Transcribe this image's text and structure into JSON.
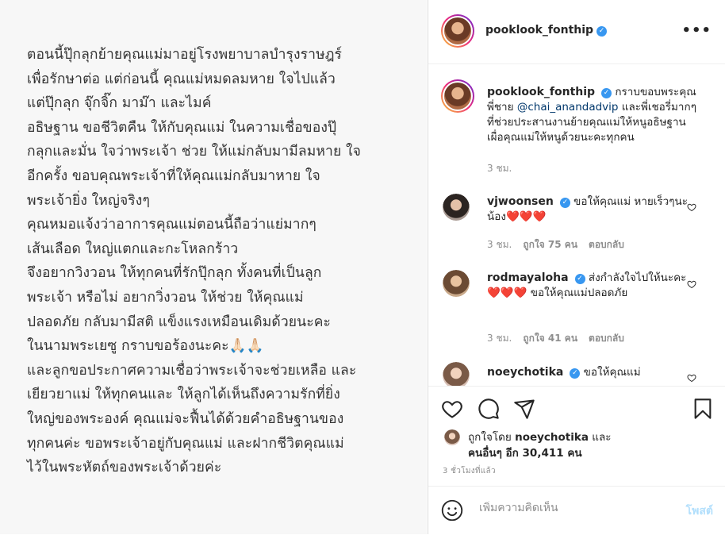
{
  "post": {
    "text": "ตอนนี้ปุ๊กลุกย้ายคุณแม่มาอยู่โรงพยาบาลบำรุงราษฎร์\nเพื่อรักษาต่อ แต่ก่อนนี้ คุณแม่หมดลมหาย ใจไปแล้ว\nแต่ปุ๊กลุก จุ๊กจิ๊ก มาม๊า และไมค์\nอธิษฐาน ขอชีวิตคืน ให้กับคุณแม่  ในความเชื่อของปุ๊\nกลุกและมั่น ใจว่าพระเจ้า ช่วย ให้แม่กลับมามีลมหาย ใจ\nอีกครั้ง ขอบคุณพระเจ้าที่ให้คุณแม่กลับมาหาย ใจ\nพระเจ้ายิ่ง ใหญ่จริงๆ\nคุณหมอแจ้งว่าอาการคุณแม่ตอนนี้ถือว่าแย่มากๆ\nเส้นเลือด ใหญ่แตกและกะโหลกร้าว\nจึงอยากวิงวอน ให้ทุกคนที่รักปุ๊กลุก  ทั้งคนที่เป็นลูก\nพระเจ้า หรือไม่ อยากวิ่งวอน ให้ช่วย ให้คุณแม่\nปลอดภัย กลับมามีสติ แข็งแรงเหมือนเดิมด้วยนะคะ\nในนามพระเยซู กราบขอร้องนะคะ🙏🏻🙏🏻\nและลูกขอประกาศความเชื่อว่าพระเจ้าจะช่วยเหลือ และ\nเยียวยาแม่  ให้ทุกคนและ ให้ลูกได้เห็นถึงความรักที่ยิ่ง\nใหญ่ของพระองค์ คุณแม่จะฟื้นได้ด้วยคำอธิษฐานของ\nทุกคนค่ะ ขอพระเจ้าอยู่กับคุณแม่ และฝากชีวิตคุณแม่\nไว้ในพระหัตถ์ของพระเจ้าด้วยค่ะ"
  },
  "header": {
    "username": "pooklook_fonthip",
    "verified_icon": "verified-badge-icon",
    "more_icon": "more-options-icon",
    "more_glyph": "•••"
  },
  "caption": {
    "username": "pooklook_fonthip",
    "text_before": "กราบขอบพระคุณพี่ชาย ",
    "mention": "@chai_anandadvip",
    "text_after": " และพี่เชอรี่มากๆที่ช่วยประสานงานย้ายคุณแม่ให้หนูอธิษฐานเผื่อคุณแม่ให้หนูด้วยนะคะทุกคน",
    "time": "3 ชม."
  },
  "comments": [
    {
      "username": "vjwoonsen",
      "text": "ขอให้คุณแม่ หายเร็วๆนะน้อง",
      "emoji": "❤️❤️❤️",
      "time": "3 ชม.",
      "likes": "ถูกใจ 75 คน",
      "reply": "ตอบกลับ"
    },
    {
      "username": "rodmayaloha",
      "text": "ส่งกำลังใจไปให้นะคะ",
      "emoji": "❤️❤️❤️",
      "text_after": " ขอให้คุณแม่ปลอดภัย",
      "time": "3 ชม.",
      "likes": "ถูกใจ 41 คน",
      "reply": "ตอบกลับ"
    },
    {
      "username": "noeychotika",
      "text": "ขอให้คุณแม่"
    }
  ],
  "actions": {
    "like_icon": "heart-icon",
    "comment_icon": "comment-icon",
    "share_icon": "share-icon",
    "save_icon": "bookmark-icon",
    "liked_by_prefix": "ถูกใจโดย ",
    "liked_by_user": "noeychotika",
    "liked_by_mid": " และ",
    "liked_by_others": "คนอื่นๆ อีก 30,411 คน",
    "time_ago": "3 ชั่วโมงที่แล้ว"
  },
  "add_comment": {
    "emoji_icon": "emoji-icon",
    "placeholder": "เพิ่มความคิดเห็น",
    "post_label": "โพสต์"
  },
  "colors": {
    "verified": "#3897f0",
    "mention": "#00376b",
    "post_button_disabled": "#b2dffc",
    "heart": "#e0245e"
  }
}
